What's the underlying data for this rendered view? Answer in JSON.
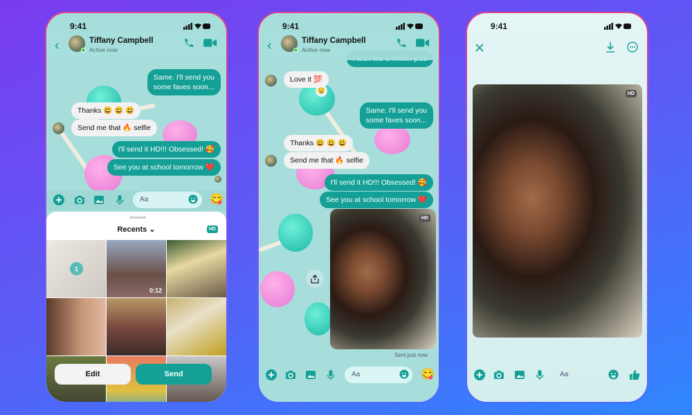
{
  "colors": {
    "accent": "#14a096",
    "chat_bg": "#a7dedc",
    "incoming_bubble": "#f2f2f2"
  },
  "status_bar": {
    "time": "9:41"
  },
  "contact": {
    "name": "Tiffany Campbell",
    "status": "Active now"
  },
  "composer": {
    "placeholder": "Aa",
    "icons": [
      "plus-icon",
      "camera-icon",
      "image-icon",
      "mic-icon",
      "emoji-icon",
      "sticker-icon"
    ]
  },
  "phone1": {
    "messages": [
      {
        "dir": "out",
        "text": "Same. I'll send you\nsome faves soon..."
      },
      {
        "dir": "in",
        "text": "Thanks 😃 😃 😃"
      },
      {
        "dir": "in",
        "text": "Send me that 🔥 selfie"
      },
      {
        "dir": "out",
        "text": "I'll send it HD!!! Obsessed!  🥰"
      },
      {
        "dir": "out",
        "text": "See you at school tomorrow ❤️"
      }
    ],
    "sheet": {
      "title": "Recents ⌄",
      "hd_label": "HD",
      "selected_count": "1",
      "video_duration": "0:12",
      "edit_label": "Edit",
      "send_label": "Send"
    }
  },
  "phone2": {
    "messages": [
      {
        "dir": "out",
        "text": "I took like a million pics"
      },
      {
        "dir": "in",
        "text": "Love it  💯",
        "reaction": "🤤"
      },
      {
        "dir": "out",
        "text": "Same. I'll send you\nsome faves soon..."
      },
      {
        "dir": "in",
        "text": "Thanks 😃 😃 😃"
      },
      {
        "dir": "in",
        "text": "Send me that 🔥 selfie"
      },
      {
        "dir": "out",
        "text": "I'll send it HD!!! Obsessed!  🥰"
      },
      {
        "dir": "out",
        "text": "See you at school tomorrow ❤️"
      }
    ],
    "photo_badge": "HD",
    "sent_status": "Sent just now"
  },
  "phone3": {
    "photo_badge": "HD",
    "icons": [
      "close-icon",
      "download-icon",
      "more-icon",
      "like-icon"
    ]
  }
}
